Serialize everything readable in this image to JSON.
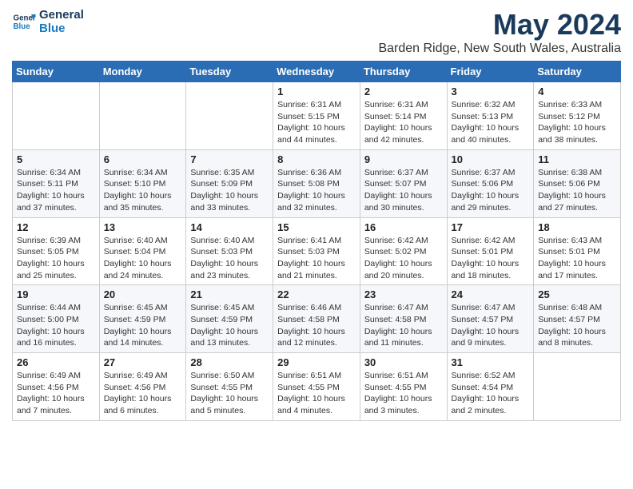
{
  "header": {
    "logo_line1": "General",
    "logo_line2": "Blue",
    "title": "May 2024",
    "subtitle": "Barden Ridge, New South Wales, Australia"
  },
  "weekdays": [
    "Sunday",
    "Monday",
    "Tuesday",
    "Wednesday",
    "Thursday",
    "Friday",
    "Saturday"
  ],
  "weeks": [
    [
      {
        "day": "",
        "info": ""
      },
      {
        "day": "",
        "info": ""
      },
      {
        "day": "",
        "info": ""
      },
      {
        "day": "1",
        "info": "Sunrise: 6:31 AM\nSunset: 5:15 PM\nDaylight: 10 hours\nand 44 minutes."
      },
      {
        "day": "2",
        "info": "Sunrise: 6:31 AM\nSunset: 5:14 PM\nDaylight: 10 hours\nand 42 minutes."
      },
      {
        "day": "3",
        "info": "Sunrise: 6:32 AM\nSunset: 5:13 PM\nDaylight: 10 hours\nand 40 minutes."
      },
      {
        "day": "4",
        "info": "Sunrise: 6:33 AM\nSunset: 5:12 PM\nDaylight: 10 hours\nand 38 minutes."
      }
    ],
    [
      {
        "day": "5",
        "info": "Sunrise: 6:34 AM\nSunset: 5:11 PM\nDaylight: 10 hours\nand 37 minutes."
      },
      {
        "day": "6",
        "info": "Sunrise: 6:34 AM\nSunset: 5:10 PM\nDaylight: 10 hours\nand 35 minutes."
      },
      {
        "day": "7",
        "info": "Sunrise: 6:35 AM\nSunset: 5:09 PM\nDaylight: 10 hours\nand 33 minutes."
      },
      {
        "day": "8",
        "info": "Sunrise: 6:36 AM\nSunset: 5:08 PM\nDaylight: 10 hours\nand 32 minutes."
      },
      {
        "day": "9",
        "info": "Sunrise: 6:37 AM\nSunset: 5:07 PM\nDaylight: 10 hours\nand 30 minutes."
      },
      {
        "day": "10",
        "info": "Sunrise: 6:37 AM\nSunset: 5:06 PM\nDaylight: 10 hours\nand 29 minutes."
      },
      {
        "day": "11",
        "info": "Sunrise: 6:38 AM\nSunset: 5:06 PM\nDaylight: 10 hours\nand 27 minutes."
      }
    ],
    [
      {
        "day": "12",
        "info": "Sunrise: 6:39 AM\nSunset: 5:05 PM\nDaylight: 10 hours\nand 25 minutes."
      },
      {
        "day": "13",
        "info": "Sunrise: 6:40 AM\nSunset: 5:04 PM\nDaylight: 10 hours\nand 24 minutes."
      },
      {
        "day": "14",
        "info": "Sunrise: 6:40 AM\nSunset: 5:03 PM\nDaylight: 10 hours\nand 23 minutes."
      },
      {
        "day": "15",
        "info": "Sunrise: 6:41 AM\nSunset: 5:03 PM\nDaylight: 10 hours\nand 21 minutes."
      },
      {
        "day": "16",
        "info": "Sunrise: 6:42 AM\nSunset: 5:02 PM\nDaylight: 10 hours\nand 20 minutes."
      },
      {
        "day": "17",
        "info": "Sunrise: 6:42 AM\nSunset: 5:01 PM\nDaylight: 10 hours\nand 18 minutes."
      },
      {
        "day": "18",
        "info": "Sunrise: 6:43 AM\nSunset: 5:01 PM\nDaylight: 10 hours\nand 17 minutes."
      }
    ],
    [
      {
        "day": "19",
        "info": "Sunrise: 6:44 AM\nSunset: 5:00 PM\nDaylight: 10 hours\nand 16 minutes."
      },
      {
        "day": "20",
        "info": "Sunrise: 6:45 AM\nSunset: 4:59 PM\nDaylight: 10 hours\nand 14 minutes."
      },
      {
        "day": "21",
        "info": "Sunrise: 6:45 AM\nSunset: 4:59 PM\nDaylight: 10 hours\nand 13 minutes."
      },
      {
        "day": "22",
        "info": "Sunrise: 6:46 AM\nSunset: 4:58 PM\nDaylight: 10 hours\nand 12 minutes."
      },
      {
        "day": "23",
        "info": "Sunrise: 6:47 AM\nSunset: 4:58 PM\nDaylight: 10 hours\nand 11 minutes."
      },
      {
        "day": "24",
        "info": "Sunrise: 6:47 AM\nSunset: 4:57 PM\nDaylight: 10 hours\nand 9 minutes."
      },
      {
        "day": "25",
        "info": "Sunrise: 6:48 AM\nSunset: 4:57 PM\nDaylight: 10 hours\nand 8 minutes."
      }
    ],
    [
      {
        "day": "26",
        "info": "Sunrise: 6:49 AM\nSunset: 4:56 PM\nDaylight: 10 hours\nand 7 minutes."
      },
      {
        "day": "27",
        "info": "Sunrise: 6:49 AM\nSunset: 4:56 PM\nDaylight: 10 hours\nand 6 minutes."
      },
      {
        "day": "28",
        "info": "Sunrise: 6:50 AM\nSunset: 4:55 PM\nDaylight: 10 hours\nand 5 minutes."
      },
      {
        "day": "29",
        "info": "Sunrise: 6:51 AM\nSunset: 4:55 PM\nDaylight: 10 hours\nand 4 minutes."
      },
      {
        "day": "30",
        "info": "Sunrise: 6:51 AM\nSunset: 4:55 PM\nDaylight: 10 hours\nand 3 minutes."
      },
      {
        "day": "31",
        "info": "Sunrise: 6:52 AM\nSunset: 4:54 PM\nDaylight: 10 hours\nand 2 minutes."
      },
      {
        "day": "",
        "info": ""
      }
    ]
  ]
}
